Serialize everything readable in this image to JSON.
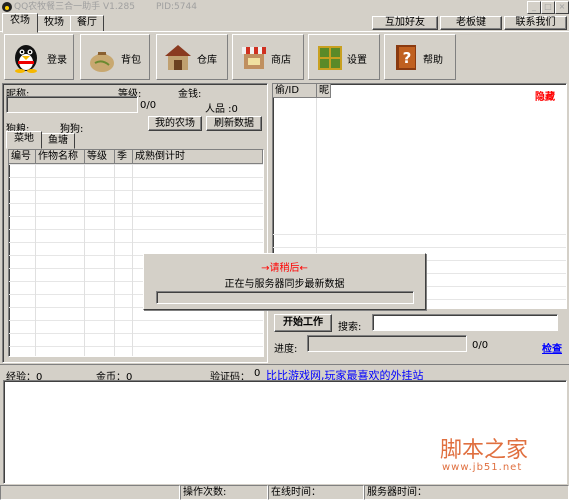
{
  "window": {
    "title": "QQ农牧餐三合一助手 V1.285",
    "pid": "PID:5744",
    "min_glyph": "_",
    "max_glyph": "□",
    "close_glyph": "×"
  },
  "tabs": [
    "农场",
    "牧场",
    "餐厅"
  ],
  "top_buttons": {
    "friends": "互加好友",
    "boss_key": "老板键",
    "contact": "联系我们"
  },
  "toolbar": {
    "login": "登录",
    "backpack": "背包",
    "warehouse": "仓库",
    "shop": "商店",
    "settings": "设置",
    "help": "帮助"
  },
  "info": {
    "nickname_label": "昵称:",
    "level_label": "等级:",
    "money_label": "金钱:",
    "exp_value": "0/0",
    "people_label": "人品 :0",
    "dog_food_label": "狗粮:",
    "dog_label": "狗狗:",
    "my_farm": "我的农场",
    "refresh": "刷新数据"
  },
  "subtabs": [
    "菜地",
    "鱼塘"
  ],
  "crop_table": {
    "headers": [
      "编号",
      "作物名称",
      "等级",
      "季",
      "成熟倒计时"
    ]
  },
  "friend_table": {
    "headers": [
      "偷/ID",
      "昵"
    ],
    "hide_link": "隐藏"
  },
  "dialog": {
    "title": "→请稍后←",
    "message": "正在与服务器同步最新数据"
  },
  "work": {
    "start_button": "开始工作",
    "search_label": "搜索:",
    "progress_label": "进度:",
    "progress_value": "0/0",
    "check_link": "检查"
  },
  "stats": {
    "exp_label": "经验：0",
    "coins_label": "金币：0",
    "captcha_label": "验证码：",
    "captcha_value": "0",
    "ad_link": "比比游戏网,玩家最喜欢的外挂站"
  },
  "watermark": {
    "brand": "脚本之家",
    "url": "www.jb51.net"
  },
  "statusbar": {
    "ops": "操作次数:",
    "online": "在线时间：",
    "server": "服务器时间："
  },
  "colors": {
    "red": "#ff0000",
    "link": "#0000ff",
    "watermark": "#e07040"
  }
}
